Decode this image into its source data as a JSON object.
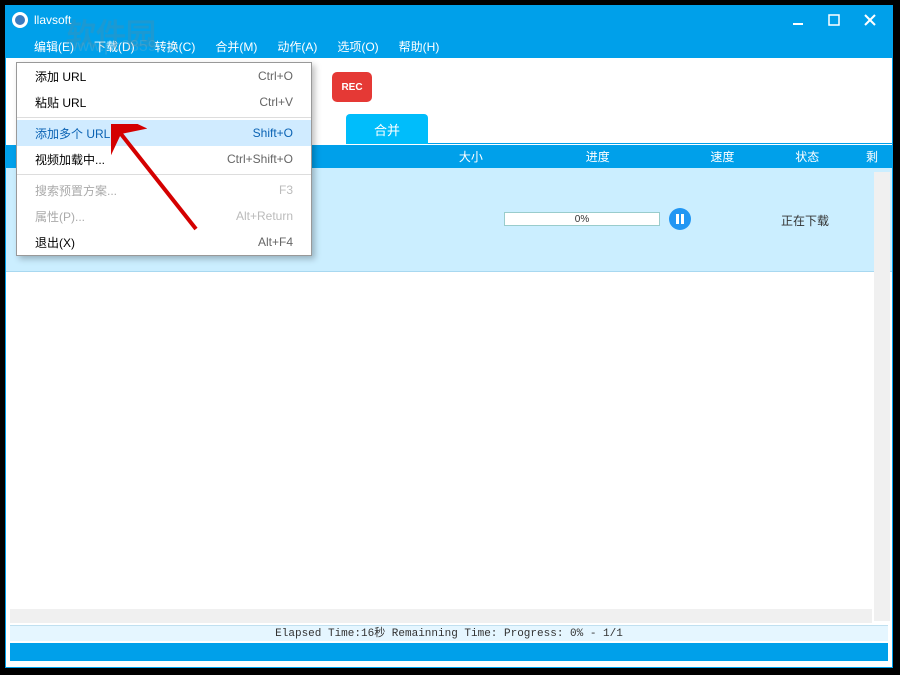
{
  "title": "llavsoft",
  "watermark_main": "软件园",
  "watermark_sub": "www.pc0359.cn",
  "menubar": [
    {
      "label": "编辑(E)"
    },
    {
      "label": "下载(D)"
    },
    {
      "label": "转换(C)"
    },
    {
      "label": "合并(M)"
    },
    {
      "label": "动作(A)"
    },
    {
      "label": "选项(O)"
    },
    {
      "label": "帮助(H)"
    }
  ],
  "rec_label": "REC",
  "tabs": {
    "merge": "合并"
  },
  "columns": {
    "size": "大小",
    "progress": "进度",
    "speed": "速度",
    "status": "状态",
    "remain": "剩"
  },
  "row": {
    "progress_text": "0%",
    "status": "正在下载"
  },
  "dropdown": [
    {
      "label": "添加 URL",
      "shortcut": "Ctrl+O",
      "disabled": false
    },
    {
      "label": "粘贴 URL",
      "shortcut": "Ctrl+V",
      "disabled": false
    },
    {
      "sep": true
    },
    {
      "label": "添加多个 URL",
      "shortcut": "Shift+O",
      "disabled": false,
      "highlight": true
    },
    {
      "label": "视频加载中...",
      "shortcut": "Ctrl+Shift+O",
      "disabled": false
    },
    {
      "sep": true
    },
    {
      "label": "搜索预置方案...",
      "shortcut": "F3",
      "disabled": true
    },
    {
      "label": "属性(P)...",
      "shortcut": "Alt+Return",
      "disabled": true
    },
    {
      "label": "退出(X)",
      "shortcut": "Alt+F4",
      "disabled": false
    }
  ],
  "status_bar": "Elapsed Time:16秒 Remainning Time: Progress: 0% - 1/1"
}
